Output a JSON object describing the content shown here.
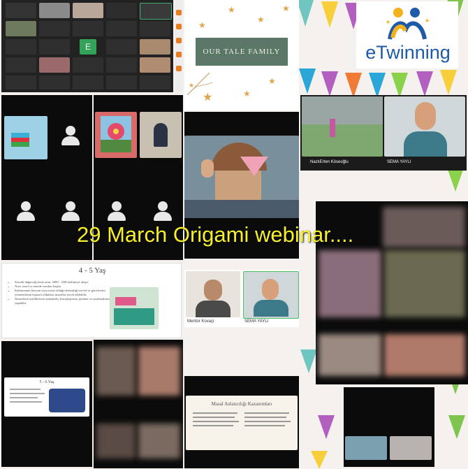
{
  "overlay": {
    "title": "29 March Origami webinar....",
    "color": "#f5f02a"
  },
  "logo": {
    "text": "eTwinning",
    "accent": "#f2b21b",
    "brand": "#1e5aa8"
  },
  "tale_card": {
    "title": "OUR TALE FAMILY",
    "bg": "#5b7768"
  },
  "participants": {
    "nazli": "NazlıErten Köseoğlu",
    "sema_top": "SEMA YAYLI",
    "mentor": "Mentor Kovaçi",
    "sema_mid": "SEMA YAYLI"
  },
  "slide_45": {
    "title": "4 - 5 Yaş",
    "bullets": [
      "Sözcük dağarcığı hızla artar. 2000 - 2500 kelimeye ulaşır.",
      "Niye, nasıl ve nerede soruları başlar.",
      "Kahramanın hayvan veya insan olduğu hezimliği tercihi ve görevlerini yönetenlerini başarılı oldukları masallar tercih edilebilir.",
      "Nesnelerin özelliklerini anlatabilir. Karşılaştırma, gözlem ve sınıflandırma yapabilir."
    ]
  },
  "slide_56": {
    "title": "5 - 6 Yaş"
  },
  "slide_masal": {
    "title": "Masal Anlatıcılığı Kazanımları"
  }
}
